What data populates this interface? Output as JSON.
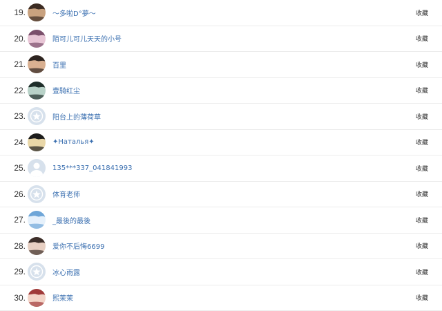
{
  "collect_label": "收藏",
  "users": [
    {
      "rank": "19.",
      "name": "～多啦D°夢～",
      "avatar": "photo-dark-hair-icon",
      "colors": [
        "#3b2b22",
        "#c9a27f"
      ]
    },
    {
      "rank": "20.",
      "name": "陌可儿可儿天天的小号",
      "avatar": "photo-anime-girl-icon",
      "colors": [
        "#7a4f6b",
        "#e8c6d6"
      ]
    },
    {
      "rank": "21.",
      "name": "百里",
      "avatar": "photo-man-icon",
      "colors": [
        "#2d2420",
        "#d9b091"
      ]
    },
    {
      "rank": "22.",
      "name": "壹騎红尘",
      "avatar": "photo-landscape-icon",
      "colors": [
        "#1f2e2a",
        "#b8d2c8"
      ]
    },
    {
      "rank": "23.",
      "name": "阳台上的薄荷草",
      "avatar": "default-star-avatar-icon",
      "colors": [
        "#d7e1ec",
        "#ffffff"
      ]
    },
    {
      "rank": "24.",
      "name": "✦Наталья✦",
      "avatar": "photo-doll-icon",
      "colors": [
        "#1c1c1c",
        "#e9d7a8"
      ]
    },
    {
      "rank": "25.",
      "name": "135***337_041841993",
      "avatar": "default-person-avatar-icon",
      "colors": [
        "#d7e1ec",
        "#ffffff"
      ]
    },
    {
      "rank": "26.",
      "name": "体育老师",
      "avatar": "default-star-avatar-icon",
      "colors": [
        "#d7e1ec",
        "#ffffff"
      ]
    },
    {
      "rank": "27.",
      "name": "_最後的最後",
      "avatar": "photo-sky-icon",
      "colors": [
        "#6fa6d8",
        "#e6f1fb"
      ]
    },
    {
      "rank": "28.",
      "name": "爱你不后悔6699",
      "avatar": "photo-woman-icon",
      "colors": [
        "#3d2f2a",
        "#e7cfc2"
      ]
    },
    {
      "rank": "29.",
      "name": "冰心雨露",
      "avatar": "default-star-avatar-icon",
      "colors": [
        "#d7e1ec",
        "#ffffff"
      ]
    },
    {
      "rank": "30.",
      "name": "熙茉茉",
      "avatar": "photo-anime-red-icon",
      "colors": [
        "#a03a3a",
        "#f3d4c8"
      ]
    }
  ]
}
